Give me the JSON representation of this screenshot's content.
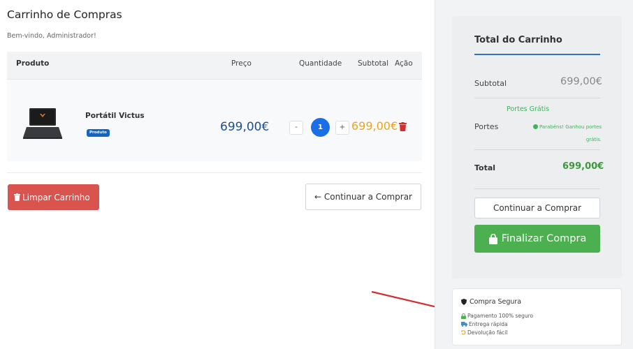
{
  "page": {
    "title": "Carrinho de Compras",
    "welcome": "Bem-vindo, Administrador!"
  },
  "table": {
    "headers": {
      "produto": "Produto",
      "preco": "Preço",
      "quantidade": "Quantidade",
      "subtotal": "Subtotal",
      "acao": "Ação"
    },
    "rows": [
      {
        "name": "Portátil Victus",
        "badge": "Produto",
        "price": "699,00€",
        "quantity": "1",
        "minus": "-",
        "plus": "+",
        "subtotal": "699,00€",
        "image_icon": "laptop-icon",
        "action_icon": "trash-icon"
      }
    ]
  },
  "actions": {
    "clear": "Limpar Carrinho",
    "clear_icon": "trash-icon",
    "continue": "← Continuar a Comprar"
  },
  "summary": {
    "title": "Total do Carrinho",
    "subtotal_label": "Subtotal",
    "subtotal_value": "699,00€",
    "shipping_title": "Portes Grátis",
    "shipping_label": "Portes",
    "shipping_note": "Parabéns! Ganhou portes grátis.",
    "total_label": "Total",
    "total_value": "699,00€",
    "continue": "Continuar a Comprar",
    "checkout": "Finalizar Compra",
    "checkout_icon": "shopping-bag-icon"
  },
  "secure": {
    "title": "Compra Segura",
    "items": [
      "Pagamento 100% seguro",
      "Entrega rápida",
      "Devolução fácil"
    ],
    "icons": [
      "shield-icon",
      "lock-icon",
      "truck-icon",
      "undo-icon"
    ]
  },
  "colors": {
    "accent_blue": "#1a6fe8",
    "price_blue": "#1c4f8f",
    "subtotal_orange": "#f0a21a",
    "danger": "#d9534f",
    "success": "#4caf50",
    "total_green": "#3c9a3c",
    "annotation_arrow": "#d32f2f"
  }
}
